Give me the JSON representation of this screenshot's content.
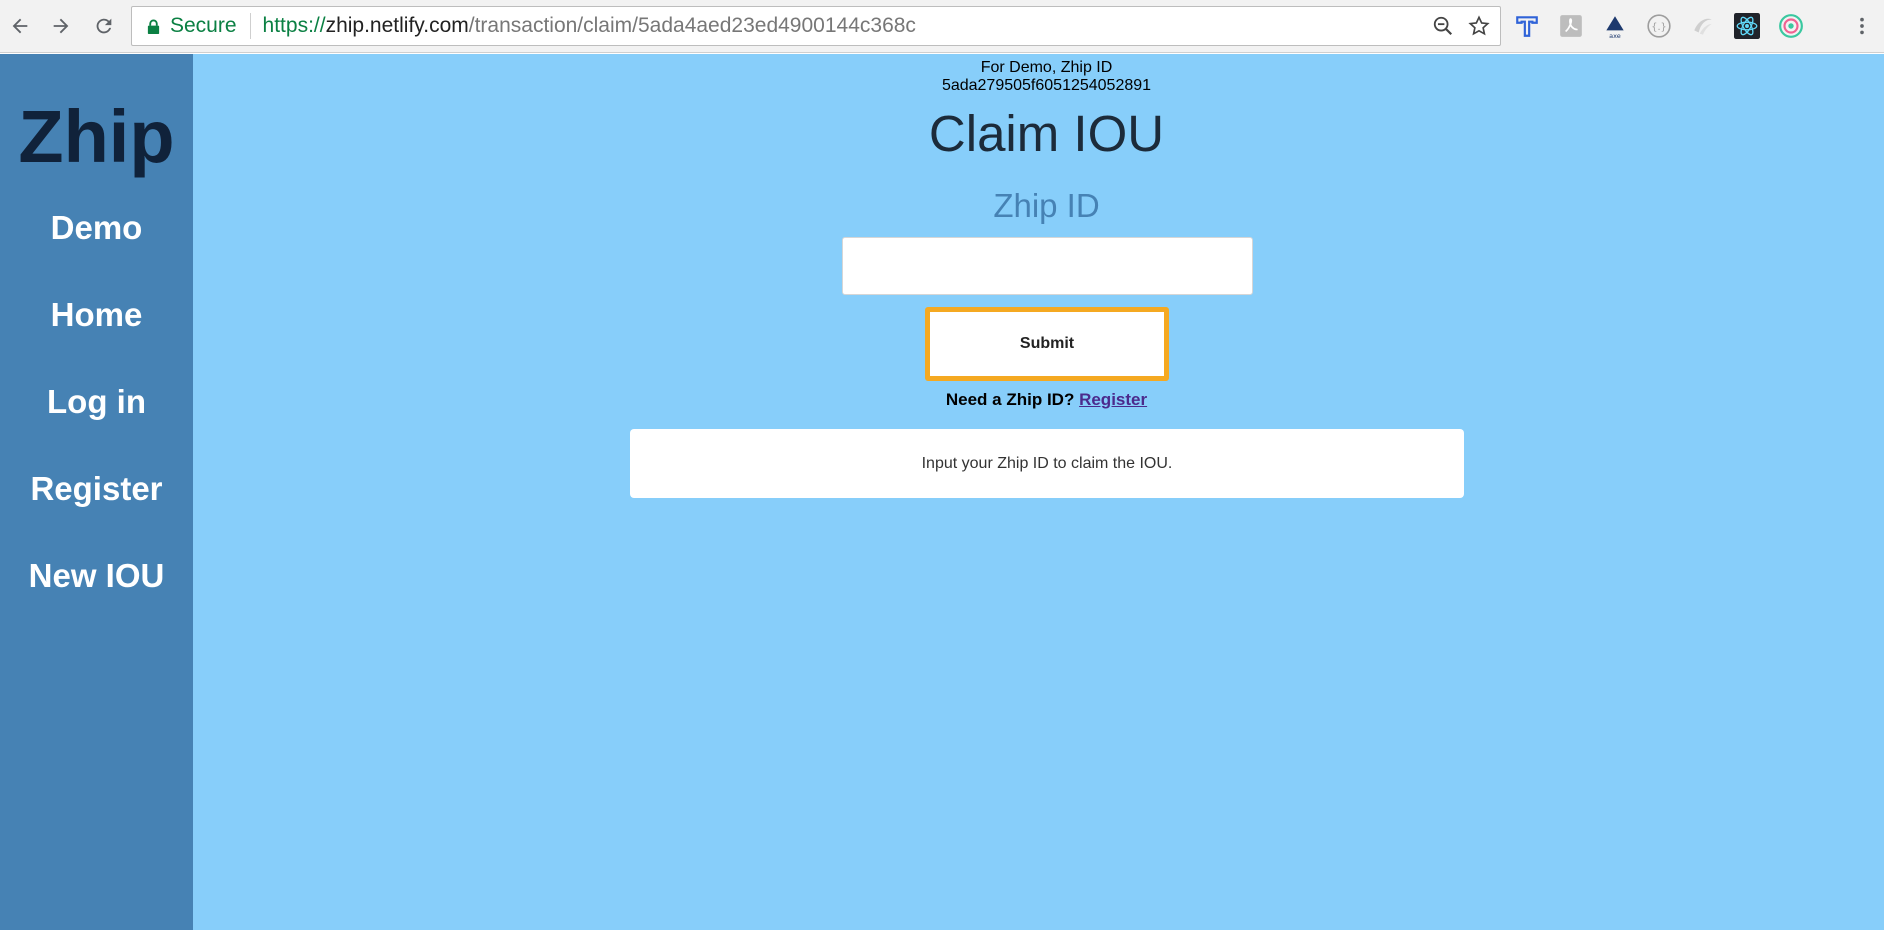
{
  "browser": {
    "secure_label": "Secure",
    "url_scheme": "https://",
    "url_host": "zhip.netlify.com",
    "url_path": "/transaction/claim/5ada4aed23ed4900144c368c"
  },
  "sidebar": {
    "brand": "Zhip",
    "items": [
      {
        "label": "Demo"
      },
      {
        "label": "Home"
      },
      {
        "label": "Log in"
      },
      {
        "label": "Register"
      },
      {
        "label": "New IOU"
      }
    ]
  },
  "main": {
    "demo_note_line1": "For Demo, Zhip ID",
    "demo_note_line2": "5ada279505f6051254052891",
    "title": "Claim IOU",
    "field_label": "Zhip ID",
    "input_value": "",
    "submit_label": "Submit",
    "need_text": "Need a Zhip ID?",
    "register_link": "Register",
    "info_message": "Input your Zhip ID to claim the IOU."
  },
  "colors": {
    "page_bg": "#87cefa",
    "sidebar_bg": "#4682b4",
    "submit_border": "#f5a921",
    "secure_green": "#0b8043"
  }
}
